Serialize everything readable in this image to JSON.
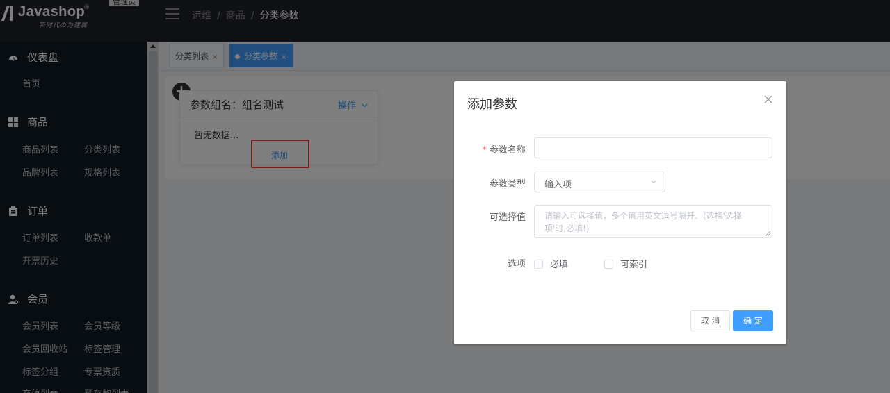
{
  "header": {
    "logo_text": "Javashop",
    "logo_reg": "®",
    "logo_sub": "新时代の为建属",
    "admin_badge": "管理员",
    "breadcrumb": [
      "运维",
      "商品",
      "分类参数"
    ],
    "separator": "/"
  },
  "sidebar": {
    "groups": [
      {
        "label": "仪表盘",
        "icon": "dashboard-icon",
        "items": [
          "首页"
        ]
      },
      {
        "label": "商品",
        "icon": "grid-icon",
        "items": [
          "商品列表",
          "分类列表",
          "品牌列表",
          "规格列表"
        ]
      },
      {
        "label": "订单",
        "icon": "clipboard-icon",
        "items": [
          "订单列表",
          "收款单",
          "开票历史"
        ]
      },
      {
        "label": "会员",
        "icon": "user-icon",
        "items": [
          "会员列表",
          "会员等级",
          "会员回收站",
          "标签管理",
          "标签分组",
          "专票资质",
          "充值列表",
          "预存款列表"
        ]
      }
    ]
  },
  "tabs": [
    {
      "label": "分类列表",
      "close": "×",
      "active": false
    },
    {
      "label": "分类参数",
      "close": "×",
      "active": true
    }
  ],
  "group_card": {
    "fab": "+",
    "title": "参数组名：组名测试",
    "action": "操作",
    "empty": "暂无数据...",
    "add": "添加"
  },
  "dialog": {
    "title": "添加参数",
    "close_icon": "close-icon",
    "fields": {
      "name_label": "参数名称",
      "name_required": "*",
      "name_value": "",
      "type_label": "参数类型",
      "type_value": "输入项",
      "options_label": "可选择值",
      "options_placeholder": "请输入可选择值，多个值用英文逗号隔开。(选择'选择项'时,必填!)",
      "flags_label": "选项",
      "required_checkbox": "必填",
      "index_checkbox": "可索引"
    },
    "buttons": {
      "cancel": "取 消",
      "confirm": "确 定"
    }
  },
  "colors": {
    "primary": "#409eff",
    "header_bg": "#20222a",
    "sidebar_bg": "#0f1a22",
    "highlight": "#e53935"
  }
}
